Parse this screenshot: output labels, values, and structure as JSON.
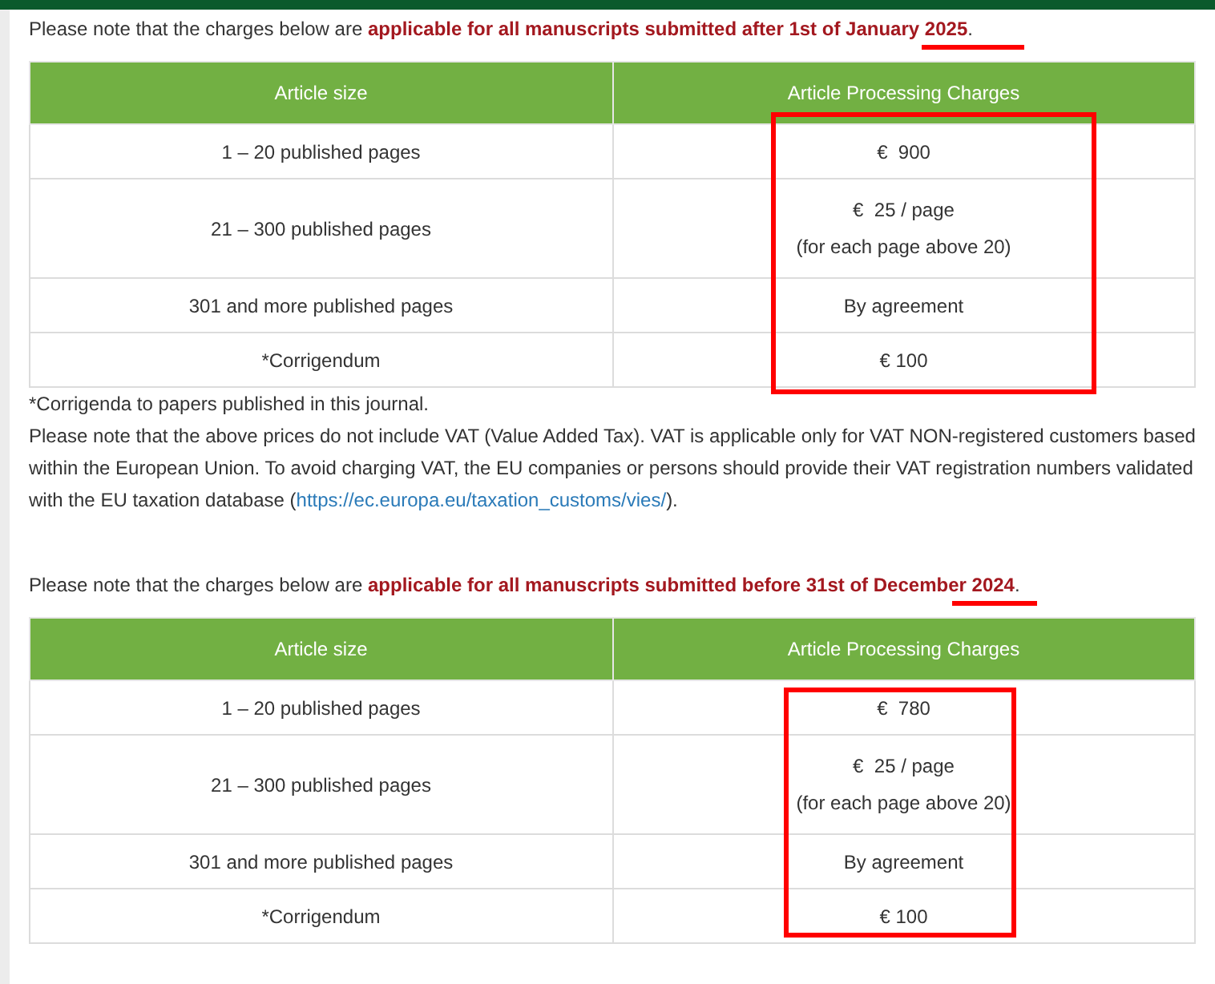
{
  "sections": [
    {
      "notice": {
        "text": "Please note that the charges below are ",
        "emphasis": "applicable for all manuscripts submitted after 1st of January ",
        "year": "2025",
        "end": ".",
        "year_underlined": true
      },
      "table": {
        "columns": [
          "Article size",
          "Article Processing Charges"
        ],
        "charges_boxed": true,
        "rows": [
          {
            "size": "1 – 20 published pages",
            "charge": [
              "€  900"
            ]
          },
          {
            "size": "21 – 300 published pages",
            "charge": [
              "€  25 / page",
              "(for each page above 20)"
            ]
          },
          {
            "size": "301 and more published pages",
            "charge": [
              "By agreement"
            ]
          },
          {
            "size": "*Corrigendum",
            "charge": [
              "€ 100"
            ]
          }
        ]
      },
      "footnote": "*Corrigenda to papers published in this journal.",
      "vat_note": {
        "before": "Please note that the above prices do not include VAT (Value Added Tax). VAT is applicable only for VAT NON-registered customers based within the European Union. To avoid charging VAT, the EU companies or persons should provide their VAT registration numbers validated with the EU taxation database (",
        "link": "https://ec.europa.eu/taxation_customs/vies/",
        "after": ")."
      }
    },
    {
      "notice": {
        "text": "Please note that the charges below are ",
        "emphasis": "applicable for all manuscripts submitted before 31st of December ",
        "year": "2024",
        "end": ".",
        "year_underlined": true
      },
      "table": {
        "columns": [
          "Article size",
          "Article Processing Charges"
        ],
        "charges_boxed": true,
        "rows": [
          {
            "size": "1 – 20 published pages",
            "charge": [
              "€  780"
            ]
          },
          {
            "size": "21 – 300 published pages",
            "charge": [
              "€  25 / page",
              "(for each page above 20)"
            ]
          },
          {
            "size": "301 and more published pages",
            "charge": [
              "By agreement"
            ]
          },
          {
            "size": "*Corrigendum",
            "charge": [
              "€ 100"
            ]
          }
        ]
      }
    }
  ]
}
